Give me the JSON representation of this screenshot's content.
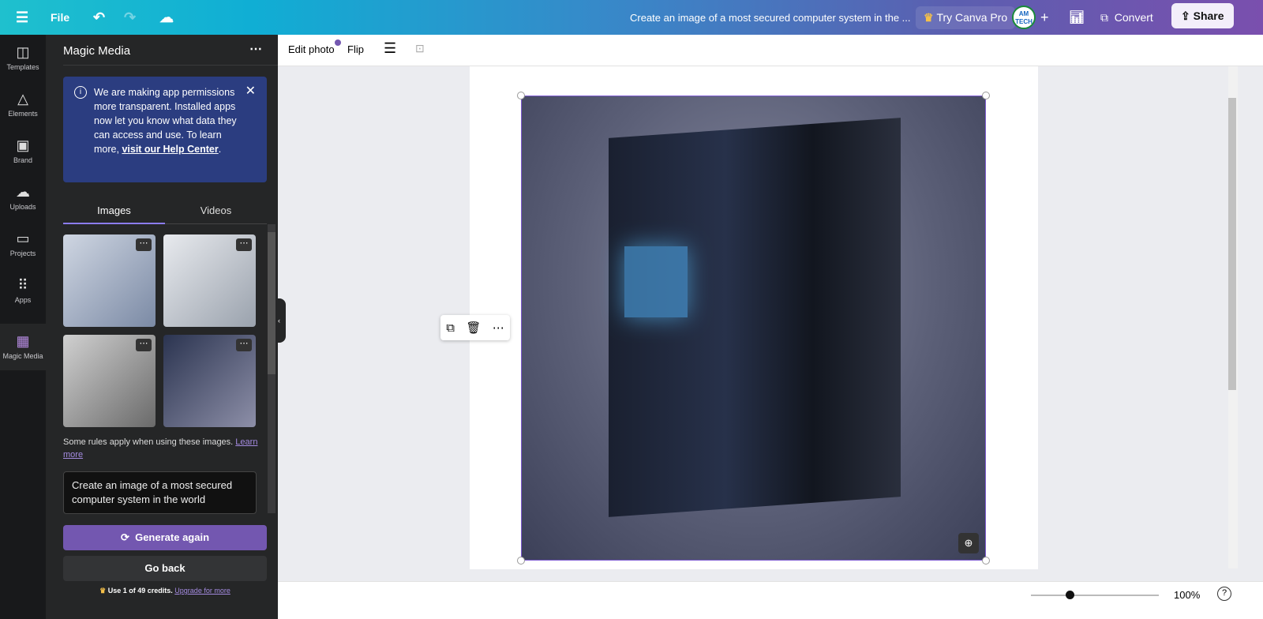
{
  "topbar": {
    "file": "File",
    "title": "Create an image of a most secured computer system in the ...",
    "try_pro": "Try Canva Pro",
    "avatar": "AM TECH",
    "convert": "Convert",
    "share": "Share"
  },
  "rail": [
    {
      "label": "Templates",
      "icon": "templates-icon"
    },
    {
      "label": "Elements",
      "icon": "elements-icon"
    },
    {
      "label": "Brand",
      "icon": "brand-icon"
    },
    {
      "label": "Uploads",
      "icon": "uploads-icon"
    },
    {
      "label": "Projects",
      "icon": "projects-icon"
    },
    {
      "label": "Apps",
      "icon": "apps-icon"
    },
    {
      "label": "Magic Media",
      "icon": "magic-media-icon"
    }
  ],
  "panel": {
    "title": "Magic Media",
    "notice": {
      "text": "We are making app permissions more transparent. Installed apps now let you know what data they can access and use. To learn more, ",
      "link": "visit our Help Center",
      "end": "."
    },
    "tabs": [
      "Images",
      "Videos"
    ],
    "rules": "Some rules apply when using these images. ",
    "rules_link": "Learn more",
    "prompt": "Create an image of a most secured computer system in the world",
    "generate": "Generate again",
    "back": "Go back",
    "credits": "Use 1 of 49 credits. ",
    "credits_link": "Upgrade for more"
  },
  "editor": {
    "edit_photo": "Edit photo",
    "flip": "Flip"
  },
  "footer": {
    "zoom": "100%",
    "zoom_fraction": 0.3
  },
  "colors": {
    "accent": "#7357b0",
    "notice": "#2b3d80"
  }
}
